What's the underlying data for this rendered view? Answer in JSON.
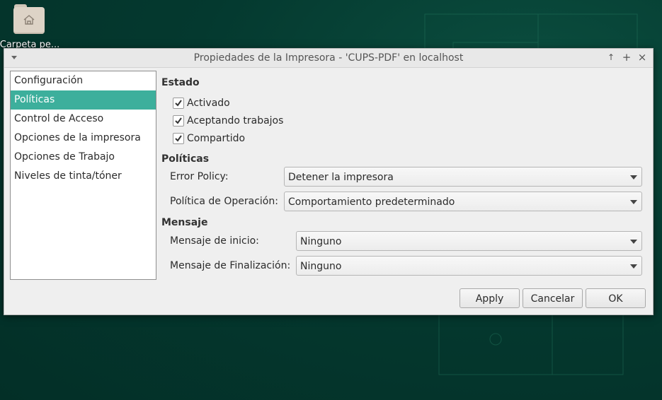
{
  "desktop": {
    "folder_label": "Carpeta pe..."
  },
  "window": {
    "title": "Propiedades de la Impresora - 'CUPS-PDF' en localhost",
    "controls": {
      "up": "↑",
      "maximize": "+",
      "close": "×"
    }
  },
  "sidebar": {
    "items": [
      {
        "label": "Configuración"
      },
      {
        "label": "Políticas",
        "selected": true
      },
      {
        "label": "Control de Acceso"
      },
      {
        "label": "Opciones de la impresora"
      },
      {
        "label": "Opciones de Trabajo"
      },
      {
        "label": "Niveles de tinta/tóner"
      }
    ]
  },
  "estado": {
    "title": "Estado",
    "checks": [
      {
        "label": "Activado",
        "checked": true
      },
      {
        "label": "Aceptando trabajos",
        "checked": true
      },
      {
        "label": "Compartido",
        "checked": true
      }
    ]
  },
  "politicas": {
    "title": "Políticas",
    "error_policy": {
      "label": "Error Policy:",
      "value": "Detener la impresora"
    },
    "operation_policy": {
      "label": "Política de Operación:",
      "value": "Comportamiento predeterminado"
    }
  },
  "mensaje": {
    "title": "Mensaje",
    "inicio": {
      "label": "Mensaje de inicio:",
      "value": "Ninguno"
    },
    "finalizacion": {
      "label": "Mensaje de Finalización:",
      "value": "Ninguno"
    }
  },
  "buttons": {
    "apply": "Apply",
    "cancel": "Cancelar",
    "ok": "OK"
  },
  "colors": {
    "selection": "#3daf9c",
    "desktop": "#033a30"
  },
  "icons": {
    "checkbox_mark": "check-icon",
    "combo": "chevron-down-icon"
  }
}
